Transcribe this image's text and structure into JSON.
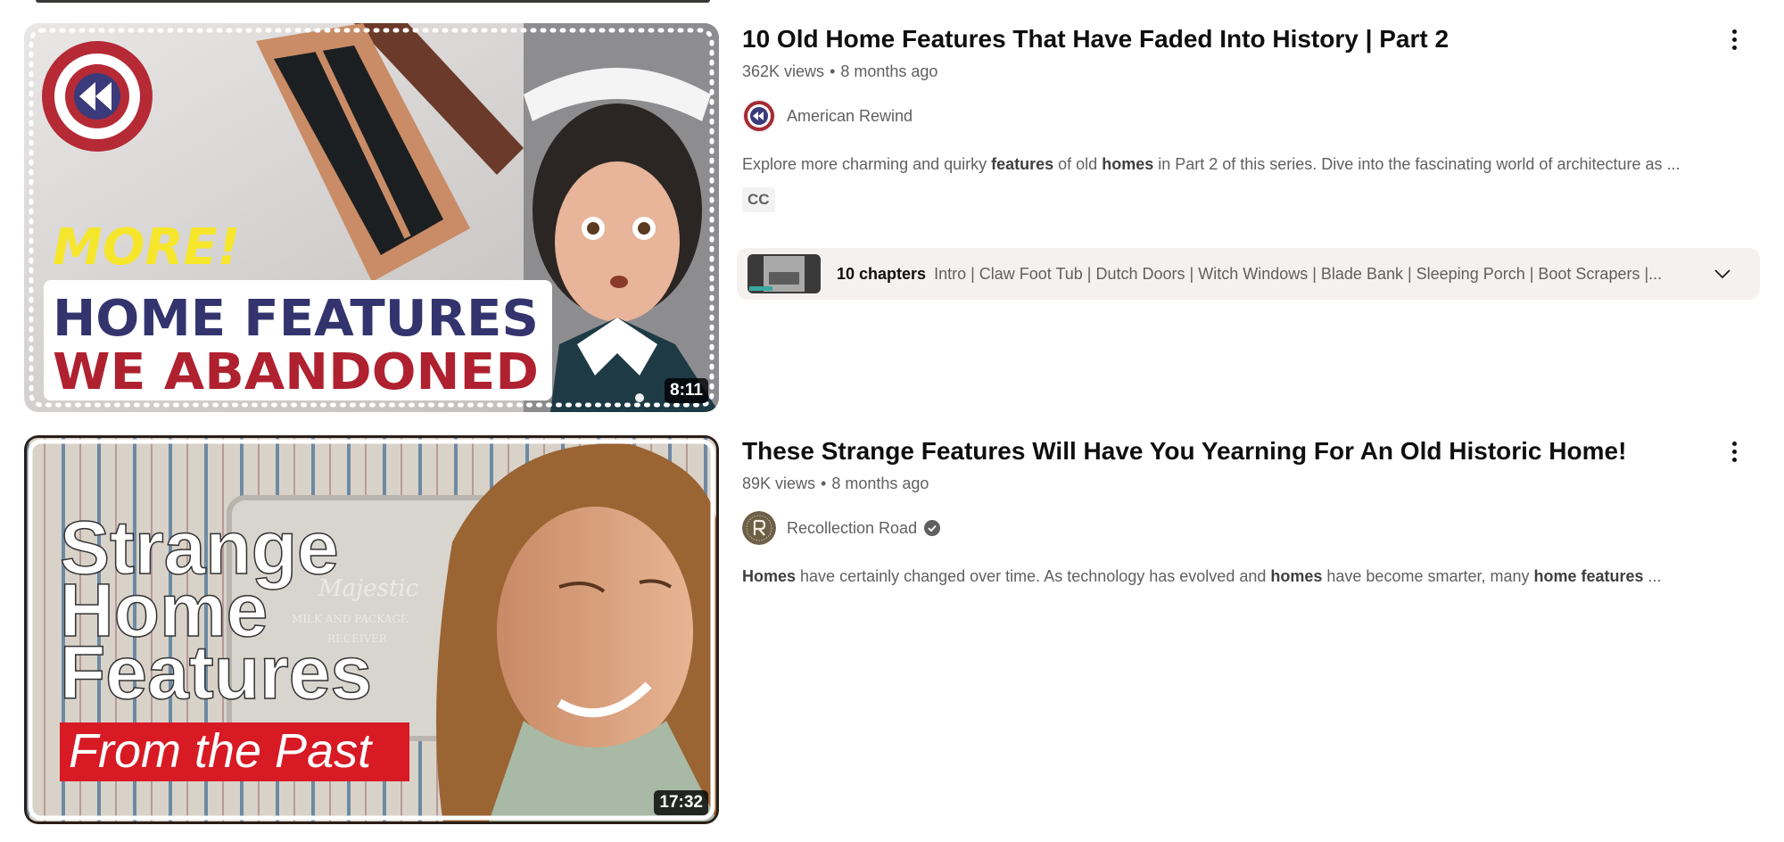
{
  "results": [
    {
      "title": "10 Old Home Features That Have Faded Into History | Part 2",
      "views": "362K views",
      "age": "8 months ago",
      "channel": "American Rewind",
      "channel_verified": false,
      "description_parts": [
        {
          "text": "Explore more charming and quirky ",
          "bold": false
        },
        {
          "text": "features",
          "bold": true
        },
        {
          "text": " of old ",
          "bold": false
        },
        {
          "text": "homes",
          "bold": true
        },
        {
          "text": " in Part 2 of this series. Dive into the fascinating world of architecture as ...",
          "bold": false
        }
      ],
      "badge": "CC",
      "duration": "8:11",
      "thumbnail_text": {
        "line1": "MORE!",
        "line2": "HOME FEATURES",
        "line3": "WE ABANDONED"
      },
      "chapters": {
        "count_label": "10 chapters",
        "list": "Intro | Claw Foot Tub | Dutch Doors | Witch Windows | Blade Bank | Sleeping Porch | Boot Scrapers |..."
      }
    },
    {
      "title": "These Strange Features Will Have You Yearning For An Old Historic Home!",
      "views": "89K views",
      "age": "8 months ago",
      "channel": "Recollection Road",
      "channel_verified": true,
      "description_parts": [
        {
          "text": "Homes",
          "bold": true
        },
        {
          "text": " have certainly changed over time. As technology has evolved and ",
          "bold": false
        },
        {
          "text": "homes",
          "bold": true
        },
        {
          "text": " have become smarter, many ",
          "bold": false
        },
        {
          "text": "home features",
          "bold": true
        },
        {
          "text": " ...",
          "bold": false
        }
      ],
      "duration": "17:32",
      "thumbnail_text": {
        "line1": "Strange",
        "line2": "Home",
        "line3": "Features",
        "line4": "From the Past",
        "sign1": "Majestic",
        "sign2": "MILK AND PACKAGE",
        "sign3": "RECEIVER"
      }
    }
  ],
  "icons": {
    "more": "more-vert-icon",
    "verified": "verified-check-icon",
    "expand": "chevron-down-icon"
  },
  "colors": {
    "chapters_bg": "#f5f1ef",
    "meta_text": "#606060",
    "title_text": "#0f0f0f"
  }
}
